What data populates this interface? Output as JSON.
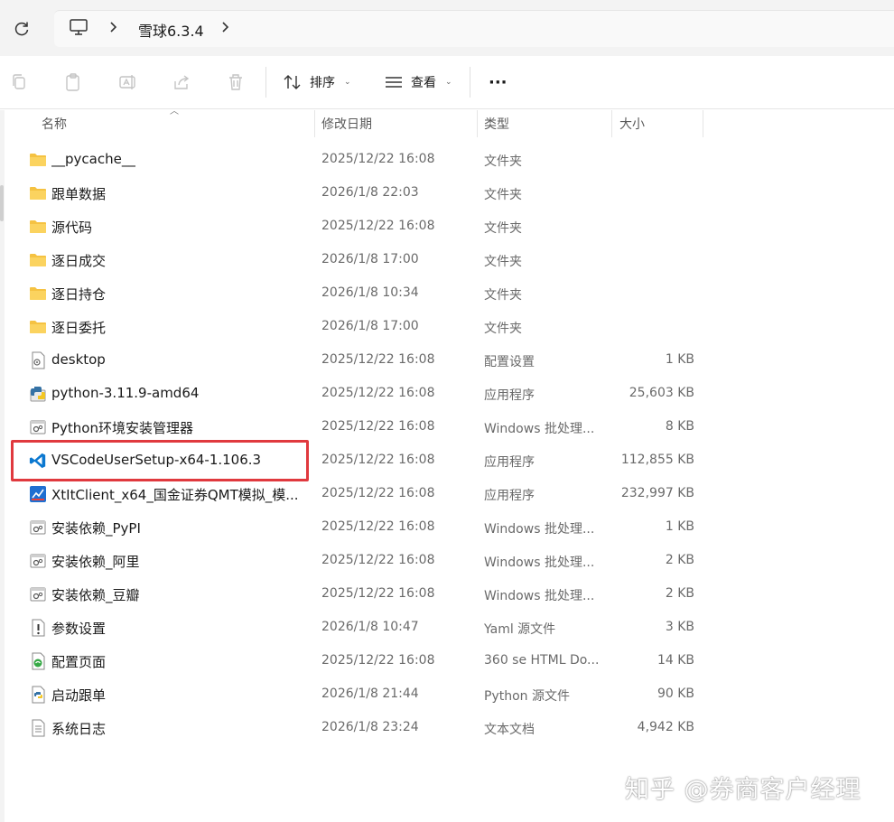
{
  "address": {
    "breadcrumb": "雪球6.3.4"
  },
  "toolbar": {
    "sort_label": "排序",
    "view_label": "查看",
    "more_label": "···"
  },
  "columns": {
    "name": "名称",
    "date": "修改日期",
    "type": "类型",
    "size": "大小"
  },
  "files": [
    {
      "name": "__pycache__",
      "date": "2025/12/22 16:08",
      "type": "文件夹",
      "size": "",
      "icon": "folder-icon"
    },
    {
      "name": "跟单数据",
      "date": "2026/1/8 22:03",
      "type": "文件夹",
      "size": "",
      "icon": "folder-icon"
    },
    {
      "name": "源代码",
      "date": "2025/12/22 16:08",
      "type": "文件夹",
      "size": "",
      "icon": "folder-icon"
    },
    {
      "name": "逐日成交",
      "date": "2026/1/8 17:00",
      "type": "文件夹",
      "size": "",
      "icon": "folder-icon"
    },
    {
      "name": "逐日持仓",
      "date": "2026/1/8 10:34",
      "type": "文件夹",
      "size": "",
      "icon": "folder-icon"
    },
    {
      "name": "逐日委托",
      "date": "2026/1/8 17:00",
      "type": "文件夹",
      "size": "",
      "icon": "folder-icon"
    },
    {
      "name": "desktop",
      "date": "2025/12/22 16:08",
      "type": "配置设置",
      "size": "1 KB",
      "icon": "config-file-icon"
    },
    {
      "name": "python-3.11.9-amd64",
      "date": "2025/12/22 16:08",
      "type": "应用程序",
      "size": "25,603 KB",
      "icon": "python-installer-icon"
    },
    {
      "name": "Python环境安装管理器",
      "date": "2025/12/22 16:08",
      "type": "Windows 批处理...",
      "size": "8 KB",
      "icon": "batch-file-icon"
    },
    {
      "name": "VSCodeUserSetup-x64-1.106.3",
      "date": "2025/12/22 16:08",
      "type": "应用程序",
      "size": "112,855 KB",
      "icon": "vscode-icon"
    },
    {
      "name": "XtItClient_x64_国金证券QMT模拟_模...",
      "date": "2025/12/22 16:08",
      "type": "应用程序",
      "size": "232,997 KB",
      "icon": "qmt-app-icon"
    },
    {
      "name": "安装依赖_PyPI",
      "date": "2025/12/22 16:08",
      "type": "Windows 批处理...",
      "size": "1 KB",
      "icon": "batch-file-icon"
    },
    {
      "name": "安装依赖_阿里",
      "date": "2025/12/22 16:08",
      "type": "Windows 批处理...",
      "size": "2 KB",
      "icon": "batch-file-icon"
    },
    {
      "name": "安装依赖_豆瓣",
      "date": "2025/12/22 16:08",
      "type": "Windows 批处理...",
      "size": "2 KB",
      "icon": "batch-file-icon"
    },
    {
      "name": "参数设置",
      "date": "2026/1/8 10:47",
      "type": "Yaml 源文件",
      "size": "3 KB",
      "icon": "yaml-file-icon"
    },
    {
      "name": "配置页面",
      "date": "2025/12/22 16:08",
      "type": "360 se HTML Do...",
      "size": "14 KB",
      "icon": "html-file-icon"
    },
    {
      "name": "启动跟单",
      "date": "2026/1/8 21:44",
      "type": "Python 源文件",
      "size": "90 KB",
      "icon": "python-file-icon"
    },
    {
      "name": "系统日志",
      "date": "2026/1/8 23:24",
      "type": "文本文档",
      "size": "4,942 KB",
      "icon": "text-file-icon"
    }
  ],
  "watermark": "知乎 @券商客户经理",
  "colors": {
    "highlight": "#e0393e",
    "folder": "#f5c242",
    "vscode": "#0b78d0"
  }
}
